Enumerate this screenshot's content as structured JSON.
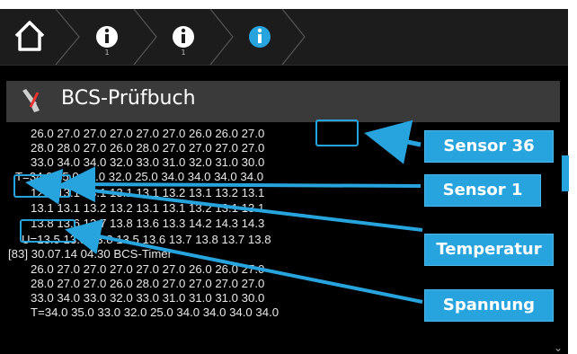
{
  "nav": {
    "breadcrumbs": [
      {
        "icon": "home-icon"
      },
      {
        "icon": "info-icon",
        "number": "1"
      },
      {
        "icon": "info-icon",
        "number": "1"
      },
      {
        "icon": "info-icon-active"
      }
    ]
  },
  "header": {
    "title": "BCS-Prüfbuch",
    "icon": "wrench-screwdriver-icon"
  },
  "log": {
    "lines": [
      "26.0 27.0 27.0 27.0 27.0 27.0 26.0 26.0 27.0",
      "28.0 28.0 27.0 26.0 28.0 27.0 27.0 27.0 27.0",
      "33.0 34.0 34.0 32.0 33.0 31.0 32.0 31.0 30.0",
      "T=34.0 35.0 33.0 32.0 25.0 34.0 34.0 34.0 34.0",
      "12.0 13.1 13.1 13.1 13.1 13.2 13.1 13.2 13.1",
      "13.1 13.1 13.2 13.2 13.1 13.1 13.2 13.1 13.1",
      "13.8 13.6 13.7 13.8 13.6 13.3 14.2 14.3 14.3",
      "U=13.5 13.8 13.8 13.5 13.6 13.7 13.8 13.7 13.8",
      "[83] 30.07.14 04:30 BCS-Timer",
      "26.0 27.0 27.0 27.0 27.0 27.0 26.0 26.0 27.0",
      "28.0 27.0 27.0 26.0 28.0 27.0 27.0 27.0 27.0",
      "33.0 34.0 33.0 32.0 33.0 31.0 31.0 31.0 30.0",
      "T=34.0 35.0 33.0 32.0 25.0 34.0 34.0 34.0 34.0"
    ]
  },
  "callouts": {
    "sensor36": "Sensor 36",
    "sensor1": "Sensor 1",
    "temperatur": "Temperatur",
    "spannung": "Spannung"
  },
  "colors": {
    "accent": "#27a3de",
    "background": "#000000",
    "header": "#3a3a3a"
  }
}
